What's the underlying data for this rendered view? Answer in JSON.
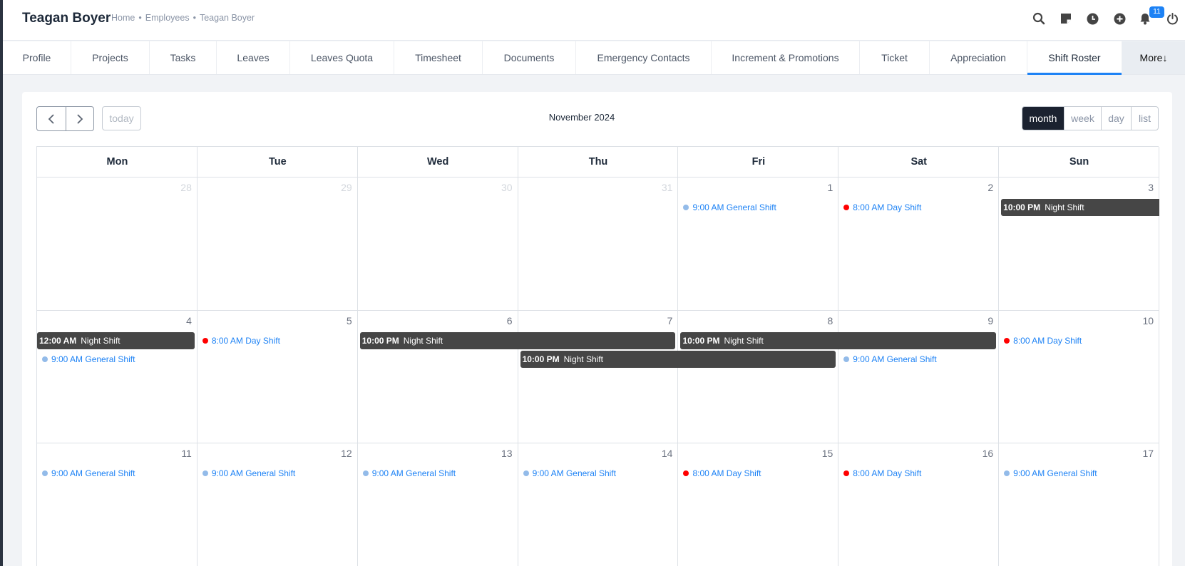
{
  "header": {
    "title": "Teagan Boyer",
    "breadcrumb": [
      "Home",
      "Employees",
      "Teagan Boyer"
    ],
    "separator": "•",
    "notification_count": "11"
  },
  "tabs": [
    {
      "label": "Profile"
    },
    {
      "label": "Projects"
    },
    {
      "label": "Tasks"
    },
    {
      "label": "Leaves"
    },
    {
      "label": "Leaves Quota"
    },
    {
      "label": "Timesheet"
    },
    {
      "label": "Documents"
    },
    {
      "label": "Emergency Contacts"
    },
    {
      "label": "Increment & Promotions"
    },
    {
      "label": "Ticket"
    },
    {
      "label": "Appreciation"
    },
    {
      "label": "Shift Roster",
      "active": true
    },
    {
      "label": "More↓"
    }
  ],
  "calendar": {
    "title": "November 2024",
    "today_label": "today",
    "views": [
      "month",
      "week",
      "day",
      "list"
    ],
    "active_view": "month",
    "weekdays": [
      "Mon",
      "Tue",
      "Wed",
      "Thu",
      "Fri",
      "Sat",
      "Sun"
    ],
    "weeks": [
      [
        "28",
        "29",
        "30",
        "31",
        "1",
        "2",
        "3"
      ],
      [
        "4",
        "5",
        "6",
        "7",
        "8",
        "9",
        "10"
      ],
      [
        "11",
        "12",
        "13",
        "14",
        "15",
        "16",
        "17"
      ]
    ],
    "colors": {
      "general": "#93bbe9",
      "day": "#ff0000",
      "night": "#464646",
      "event_text": "#1d82f5"
    },
    "events": [
      {
        "week": 0,
        "day": 4,
        "kind": "dot",
        "time": "9:00 AM",
        "title": "General Shift",
        "color": "#93bbe9"
      },
      {
        "week": 0,
        "day": 5,
        "kind": "dot",
        "time": "8:00 AM",
        "title": "Day Shift",
        "color": "#ff0000"
      },
      {
        "week": 0,
        "day": 6,
        "kind": "block",
        "time": "10:00 PM",
        "title": "Night Shift",
        "span": 1,
        "row": 0
      },
      {
        "week": 1,
        "day": 0,
        "kind": "block",
        "time": "12:00 AM",
        "title": "Night Shift",
        "span": 1,
        "row": 0
      },
      {
        "week": 1,
        "day": 0,
        "kind": "dot",
        "time": "9:00 AM",
        "title": "General Shift",
        "color": "#93bbe9",
        "row": 1
      },
      {
        "week": 1,
        "day": 1,
        "kind": "dot",
        "time": "8:00 AM",
        "title": "Day Shift",
        "color": "#ff0000"
      },
      {
        "week": 1,
        "day": 2,
        "kind": "block",
        "time": "10:00 PM",
        "title": "Night Shift",
        "span": 2,
        "row": 0
      },
      {
        "week": 1,
        "day": 3,
        "kind": "block",
        "time": "10:00 PM",
        "title": "Night Shift",
        "span": 2,
        "row": 1
      },
      {
        "week": 1,
        "day": 4,
        "kind": "block",
        "time": "10:00 PM",
        "title": "Night Shift",
        "span": 2,
        "row": 0
      },
      {
        "week": 1,
        "day": 5,
        "kind": "dot",
        "time": "9:00 AM",
        "title": "General Shift",
        "color": "#93bbe9",
        "row": 1
      },
      {
        "week": 1,
        "day": 6,
        "kind": "dot",
        "time": "8:00 AM",
        "title": "Day Shift",
        "color": "#ff0000"
      },
      {
        "week": 2,
        "day": 0,
        "kind": "dot",
        "time": "9:00 AM",
        "title": "General Shift",
        "color": "#93bbe9"
      },
      {
        "week": 2,
        "day": 1,
        "kind": "dot",
        "time": "9:00 AM",
        "title": "General Shift",
        "color": "#93bbe9"
      },
      {
        "week": 2,
        "day": 2,
        "kind": "dot",
        "time": "9:00 AM",
        "title": "General Shift",
        "color": "#93bbe9"
      },
      {
        "week": 2,
        "day": 3,
        "kind": "dot",
        "time": "9:00 AM",
        "title": "General Shift",
        "color": "#93bbe9"
      },
      {
        "week": 2,
        "day": 4,
        "kind": "dot",
        "time": "8:00 AM",
        "title": "Day Shift",
        "color": "#ff0000"
      },
      {
        "week": 2,
        "day": 5,
        "kind": "dot",
        "time": "8:00 AM",
        "title": "Day Shift",
        "color": "#ff0000"
      },
      {
        "week": 2,
        "day": 6,
        "kind": "dot",
        "time": "9:00 AM",
        "title": "General Shift",
        "color": "#93bbe9"
      }
    ]
  }
}
